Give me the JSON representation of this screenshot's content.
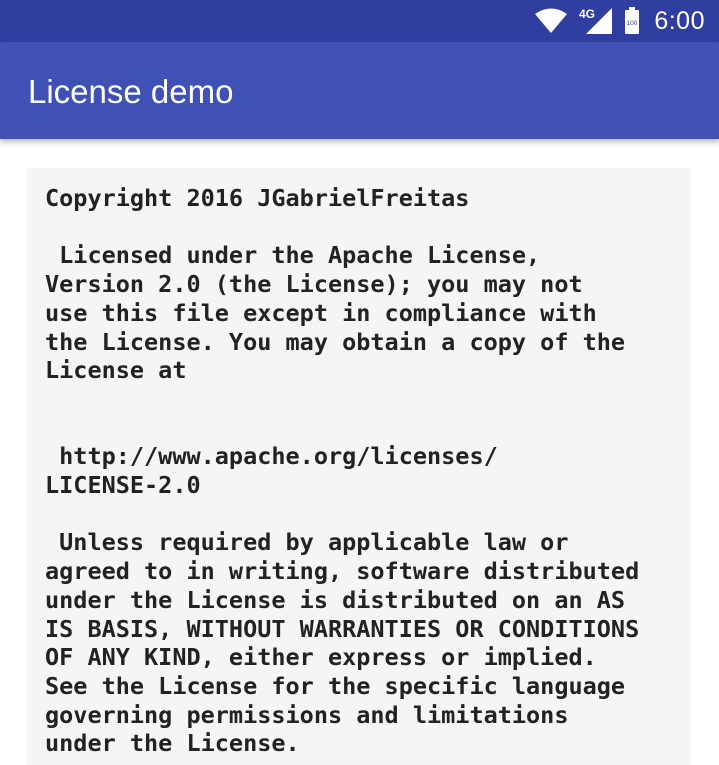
{
  "status_bar": {
    "time": "6:00",
    "network": "4G",
    "battery": "100",
    "icons": [
      "wifi-icon",
      "cellular-signal-icon",
      "battery-icon"
    ]
  },
  "app_bar": {
    "title": "License demo"
  },
  "license": {
    "text": "Copyright 2016 JGabrielFreitas\n\n Licensed under the Apache License,\nVersion 2.0 (the License); you may not\nuse this file except in compliance with\nthe License. You may obtain a copy of the\nLicense at\n\n\n http://www.apache.org/licenses/\nLICENSE-2.0\n\n Unless required by applicable law or\nagreed to in writing, software distributed\nunder the License is distributed on an AS\nIS BASIS, WITHOUT WARRANTIES OR CONDITIONS\nOF ANY KIND, either express or implied.\nSee the License for the specific language\ngoverning permissions and limitations\nunder the License."
  },
  "colors": {
    "status_bar": "#303f9f",
    "app_bar": "#3f51b5",
    "license_background": "#f5f5f5",
    "license_text": "#222222"
  }
}
